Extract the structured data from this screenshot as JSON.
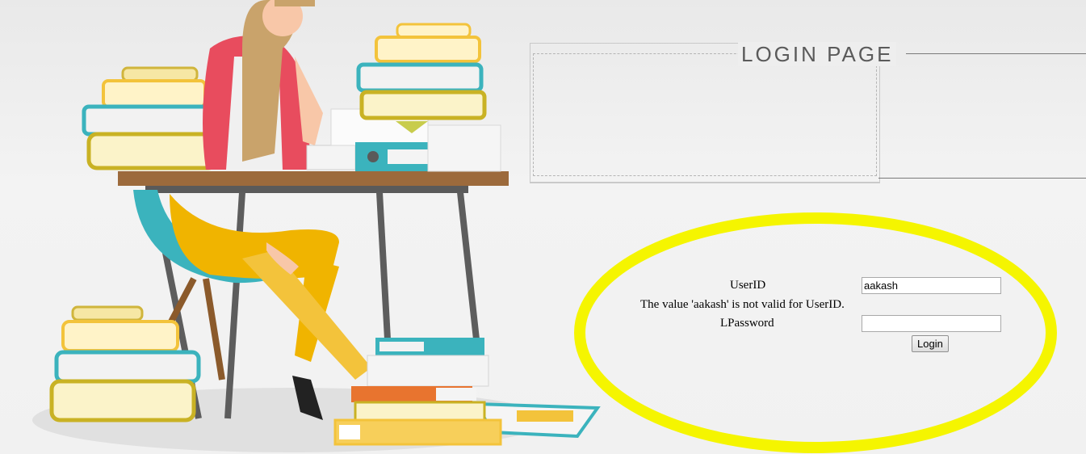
{
  "header": {
    "title": "LOGIN PAGE"
  },
  "form": {
    "userid_label": "UserID",
    "userid_value": "aakash",
    "error_message": "The value 'aakash' is not valid for UserID.",
    "password_label": "LPassword",
    "password_value": "",
    "login_label": "Login"
  },
  "colors": {
    "highlight": "#f5f500",
    "teal": "#3bb3bd",
    "yellow": "#f3c33b",
    "pink": "#e84c5e"
  }
}
